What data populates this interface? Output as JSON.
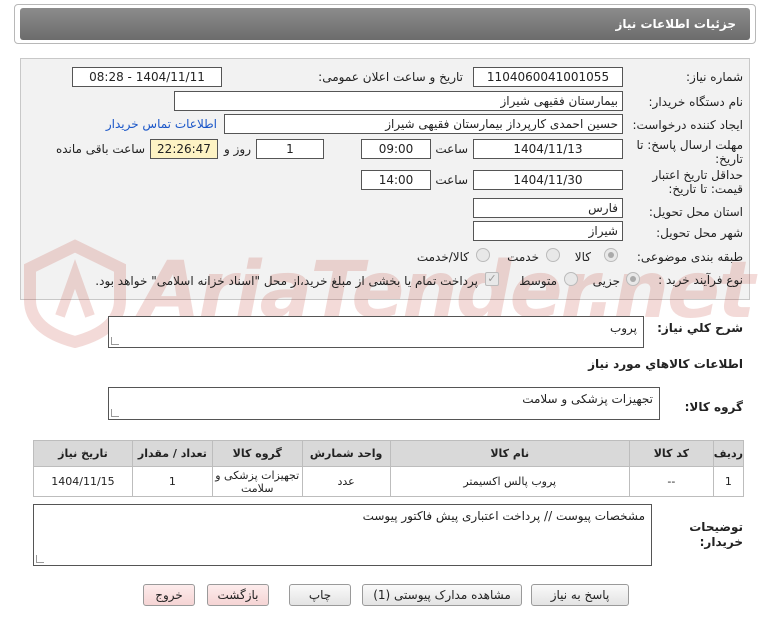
{
  "header": {
    "title": "جزئیات اطلاعات نیاز"
  },
  "form": {
    "need_number_label": "شماره نیاز:",
    "need_number": "1104060041001055",
    "announce_label": "تاریخ و ساعت اعلان عمومی:",
    "announce_value": "1404/11/11 - 08:28",
    "buyer_org_label": "نام دستگاه خریدار:",
    "buyer_org": "بیمارستان فقیهی شیراز",
    "creator_label": "ایجاد کننده درخواست:",
    "creator": "حسین احمدی کارپرداز بیمارستان فقیهی شیراز",
    "contact_link": "اطلاعات تماس خریدار",
    "deadline_label_1": "مهلت ارسال پاسخ: تا",
    "deadline_label_2": "تاریخ:",
    "deadline_date": "1404/11/13",
    "time_word": "ساعت",
    "deadline_time": "09:00",
    "days_value": "1",
    "days_word": "روز و",
    "remaining_time": "22:26:47",
    "remaining_word": "ساعت باقی مانده",
    "validity_label_1": "حداقل تاریخ اعتبار",
    "validity_label_2": "قیمت: تا تاریخ:",
    "validity_date": "1404/11/30",
    "validity_time": "14:00",
    "province_label": "استان محل تحویل:",
    "province": "فارس",
    "city_label": "شهر محل تحویل:",
    "city": "شیراز",
    "category_label": "طبقه بندی موضوعی:",
    "category_options": [
      "کالا",
      "خدمت",
      "کالا/خدمت"
    ],
    "process_label": "نوع فرآیند خرید :",
    "process_options": [
      "جزیی",
      "متوسط"
    ],
    "payment_note": "پرداخت تمام یا بخشی از مبلغ خرید،از محل \"اسناد خزانه اسلامی\" خواهد بود."
  },
  "summary": {
    "label": "شرح کلي نياز:",
    "value": "پروب"
  },
  "goods_section_title": "اطلاعات کالاهاي مورد نياز",
  "goods_group": {
    "label": "گروه کالا:",
    "value": "تجهیزات پزشکی و سلامت"
  },
  "table": {
    "headers": [
      "ردیف",
      "کد کالا",
      "نام کالا",
      "واحد شمارش",
      "گروه کالا",
      "تعداد / مقدار",
      "تاریخ نیاز"
    ],
    "rows": [
      [
        "1",
        "--",
        "پروب پالس اکسیمتر",
        "عدد",
        "تجهیزات پزشکی و سلامت",
        "1",
        "1404/11/15"
      ]
    ]
  },
  "buyer_notes": {
    "label_1": "توضیحات",
    "label_2": "خریدار:",
    "value": "مشخصات پیوست // پرداخت اعتباری پیش فاکتور پیوست"
  },
  "buttons": {
    "reply": "پاسخ به نیاز",
    "docs": "مشاهده مدارک پیوستی (1)",
    "print": "چاپ",
    "back": "بازگشت",
    "exit": "خروج"
  },
  "watermark_text": "AriaTender.net",
  "colors": {
    "link": "#1a56c8",
    "header_bg": "#7a7a7a",
    "highlight": "#fdf3c4"
  }
}
